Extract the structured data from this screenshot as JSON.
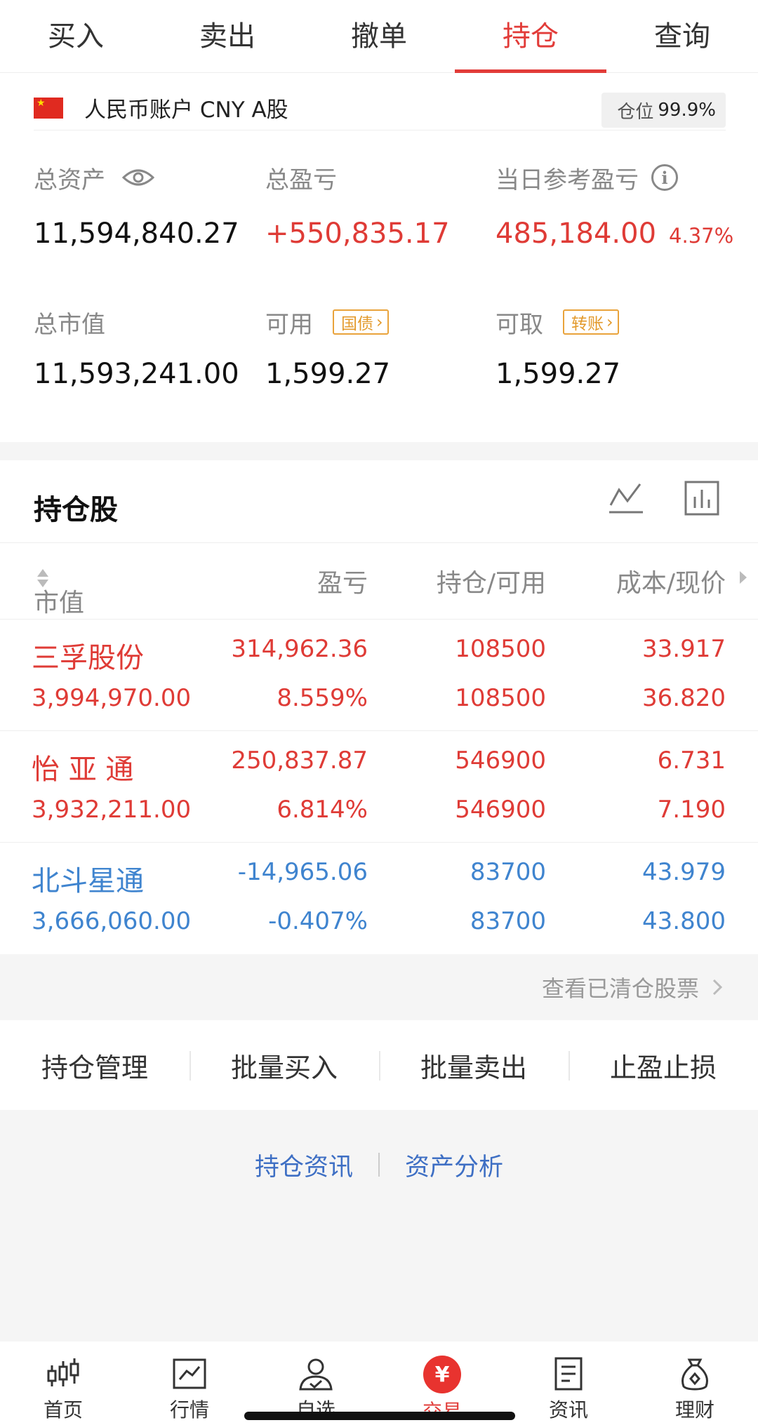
{
  "tabs": [
    {
      "label": "买入"
    },
    {
      "label": "卖出"
    },
    {
      "label": "撤单"
    },
    {
      "label": "持仓",
      "active": true
    },
    {
      "label": "查询"
    }
  ],
  "account": {
    "name": "人民币账户 CNY A股",
    "position_label": "仓位",
    "position_value": "99.9%"
  },
  "metrics": {
    "total_assets": {
      "label": "总资产",
      "value": "11,594,840.27"
    },
    "total_pl": {
      "label": "总盈亏",
      "value": "+550,835.17"
    },
    "daily_pl": {
      "label": "当日参考盈亏",
      "value": "485,184.00",
      "pct": "4.37%"
    },
    "market_value": {
      "label": "总市值",
      "value": "11,593,241.00"
    },
    "available": {
      "label": "可用",
      "tag": "国债",
      "value": "1,599.27"
    },
    "withdrawable": {
      "label": "可取",
      "tag": "转账",
      "value": "1,599.27"
    }
  },
  "holdings": {
    "title": "持仓股",
    "columns": {
      "market_value": "市值",
      "profit_loss": "盈亏",
      "position": "持仓/可用",
      "cost_price": "成本/现价"
    },
    "rows": [
      {
        "name": "三孚股份",
        "market_value": "3,994,970.00",
        "pl": "314,962.36",
        "pl_pct": "8.559%",
        "hold": "108500",
        "avail": "108500",
        "cost": "33.917",
        "price": "36.820",
        "trend": "up"
      },
      {
        "name": "怡 亚 通",
        "market_value": "3,932,211.00",
        "pl": "250,837.87",
        "pl_pct": "6.814%",
        "hold": "546900",
        "avail": "546900",
        "cost": "6.731",
        "price": "7.190",
        "trend": "up"
      },
      {
        "name": "北斗星通",
        "market_value": "3,666,060.00",
        "pl": "-14,965.06",
        "pl_pct": "-0.407%",
        "hold": "83700",
        "avail": "83700",
        "cost": "43.979",
        "price": "43.800",
        "trend": "down"
      }
    ]
  },
  "cleared_link": "查看已清仓股票",
  "actions": [
    "持仓管理",
    "批量买入",
    "批量卖出",
    "止盈止损"
  ],
  "info_links": [
    "持仓资讯",
    "资产分析"
  ],
  "bottom_nav": [
    {
      "label": "首页",
      "icon": "candlestick-icon"
    },
    {
      "label": "行情",
      "icon": "chart-line-icon"
    },
    {
      "label": "自选",
      "icon": "person-check-icon"
    },
    {
      "label": "交易",
      "icon": "yuan-icon",
      "active": true
    },
    {
      "label": "资讯",
      "icon": "document-icon"
    },
    {
      "label": "理财",
      "icon": "money-bag-icon"
    }
  ],
  "colors": {
    "up": "#df3b36",
    "down": "#3f84cf",
    "accent": "#e23c39",
    "tag": "#e39a2c",
    "link": "#3e6fc4"
  }
}
